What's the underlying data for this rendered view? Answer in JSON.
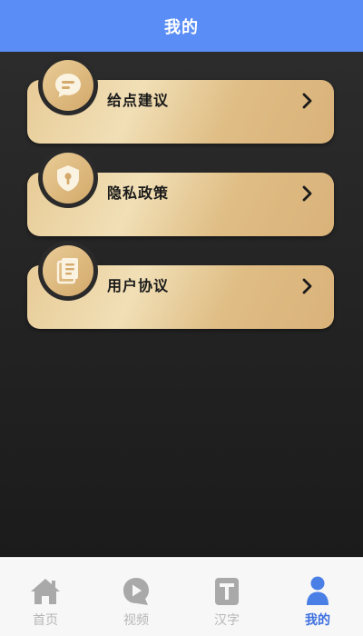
{
  "header": {
    "title": "我的"
  },
  "menu": {
    "items": [
      {
        "label": "给点建议",
        "icon": "chat-bubble-icon"
      },
      {
        "label": "隐私政策",
        "icon": "shield-icon"
      },
      {
        "label": "用户协议",
        "icon": "document-icon"
      }
    ]
  },
  "tabbar": {
    "tabs": [
      {
        "label": "首页",
        "icon": "home-icon",
        "active": false
      },
      {
        "label": "视频",
        "icon": "video-icon",
        "active": false
      },
      {
        "label": "汉字",
        "icon": "text-t-icon",
        "active": false
      },
      {
        "label": "我的",
        "icon": "person-icon",
        "active": true
      }
    ]
  },
  "colors": {
    "header_bg": "#5a8df5",
    "active_tab": "#3d6fe0",
    "inactive_tab": "#b6b6b6",
    "card_gold": "#e8cc98"
  }
}
